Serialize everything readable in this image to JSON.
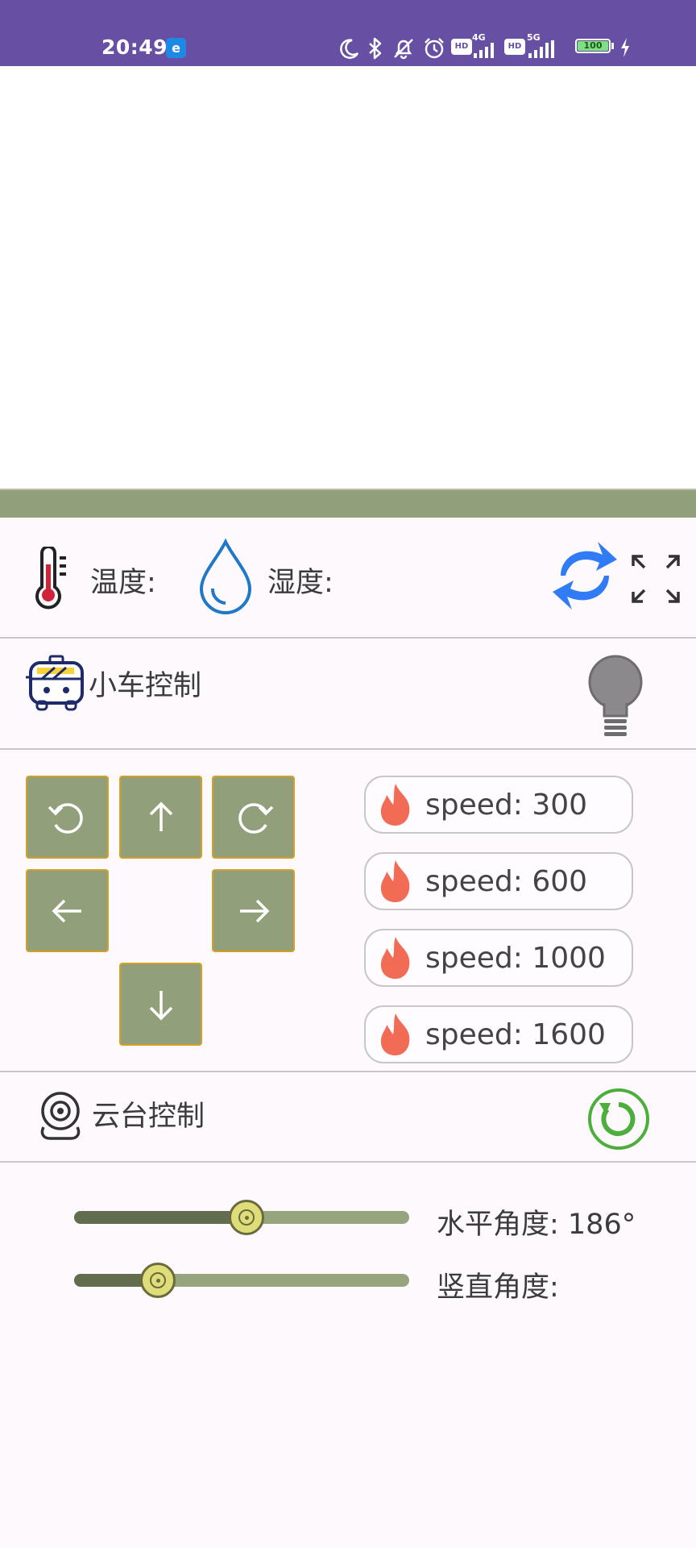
{
  "status_bar": {
    "time": "20:49",
    "app_icon": "e",
    "network_1": "4G",
    "network_2": "5G",
    "hd_1": "HD",
    "hd_2": "HD",
    "battery": "100",
    "icons": [
      "moon-icon",
      "bluetooth-icon",
      "bell-off-icon",
      "alarm-icon",
      "signal-icon",
      "battery-icon",
      "charging-icon"
    ]
  },
  "sensors": {
    "temperature_label": "温度:",
    "humidity_label": "湿度:",
    "icons": [
      "thermometer-icon",
      "water-drop-icon",
      "refresh-icon",
      "fullscreen-icon"
    ]
  },
  "car_control": {
    "title": "小车控制",
    "icons": [
      "robot-car-icon",
      "light-bulb-icon"
    ]
  },
  "direction_pad": {
    "buttons": [
      "rotate-left",
      "up",
      "rotate-right",
      "left",
      "right",
      "down"
    ]
  },
  "speeds": [
    {
      "label": "speed: 300"
    },
    {
      "label": "speed: 600"
    },
    {
      "label": "speed: 1000"
    },
    {
      "label": "speed: 1600"
    }
  ],
  "gimbal_control": {
    "title": "云台控制",
    "icons": [
      "camera-icon",
      "reset-icon"
    ]
  },
  "sliders": {
    "horizontal": {
      "label": "水平角度: 186°",
      "fraction": 0.515
    },
    "vertical": {
      "label": "竖直角度:",
      "fraction": 0.25
    }
  },
  "colors": {
    "header": "#6750a4",
    "olive_bar": "#929f7b",
    "button_fill": "#919f7a",
    "button_border": "#d4a025",
    "flame": "#f26b55",
    "refresh": "#2f7cf6",
    "reset": "#4caf3c"
  }
}
